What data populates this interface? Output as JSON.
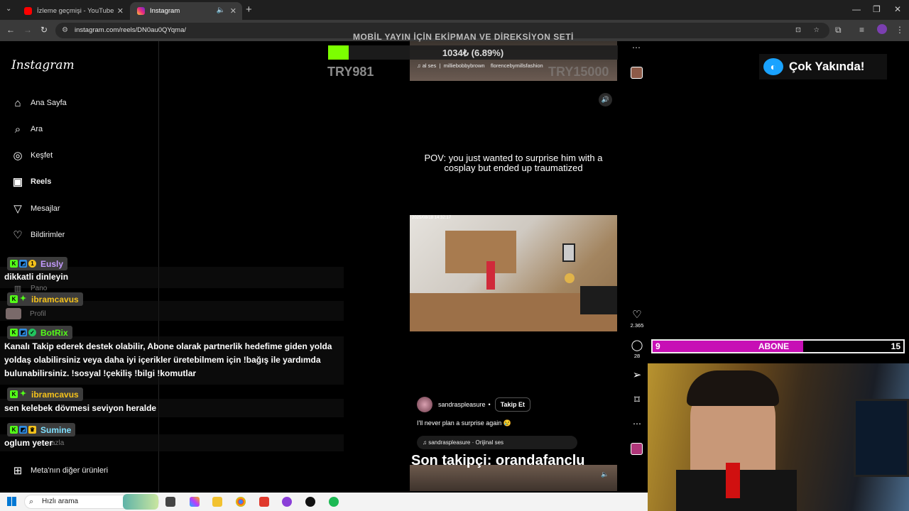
{
  "browser": {
    "tabs": [
      {
        "title": "İzleme geçmişi - YouTube",
        "active": false,
        "favicon_color": "#ff0000"
      },
      {
        "title": "Instagram",
        "active": true,
        "favicon_color": "#e1306c"
      }
    ],
    "url": "instagram.com/reels/DN0au0QYqma/"
  },
  "sidebar": {
    "logo": "Instagram",
    "items": [
      {
        "label": "Ana Sayfa",
        "icon": "home-icon"
      },
      {
        "label": "Ara",
        "icon": "search-icon"
      },
      {
        "label": "Keşfet",
        "icon": "compass-icon"
      },
      {
        "label": "Reels",
        "icon": "reels-icon"
      },
      {
        "label": "Mesajlar",
        "icon": "send-icon"
      },
      {
        "label": "Bildirimler",
        "icon": "heart-icon"
      },
      {
        "label": "Pano",
        "icon": "chart-icon"
      },
      {
        "label": "Profil",
        "icon": "avatar"
      }
    ],
    "more_fragment": "azla",
    "meta_label": "Meta'nın diğer ürünleri"
  },
  "reel": {
    "top_audio": "al ses",
    "top_user": "milliebobbybrown",
    "top_user2": "florencebymillsfashion",
    "caption_overlay": "POV: you just wanted to surprise him with a cosplay but ended up traumatized",
    "cam_timestamp": "2025/08/18 14:32:17",
    "author": "sandraspleasure",
    "follow_label": "Takip Et",
    "caption": "I'll never plan a surprise again 😢",
    "audio": "sandraspleasure · Orijinal ses",
    "likes": "2.365",
    "comments": "28"
  },
  "overlays": {
    "equipment_title": "MOBİL YAYIN İÇİN EKİPMAN VE DİREKSİYON SETİ",
    "goal_text": "1034₺ (6.89%)",
    "goal_progress": 0.0689,
    "goal_fill_color": "#7cff00",
    "price_left": "TRY981",
    "price_right": "TRY15000",
    "coming_soon": "Çok Yakında!",
    "sub_left": "9",
    "sub_label": "ABONE",
    "sub_right": "15",
    "sub_progress": 0.6,
    "sub_color": "#c70fb5",
    "last_follower": "Son takipçi: orandafanclu"
  },
  "chat": [
    {
      "user": "Eusly",
      "color": "#c49bff",
      "message": "dikkatli dinleyin"
    },
    {
      "user": "ibramcavus",
      "color": "#f5c21b",
      "message": ""
    },
    {
      "user": "BotRix",
      "color": "#53fc18",
      "message": "Kanalı Takip ederek destek olabilir, Abone olarak partnerlik hedefime giden yolda yoldaş olabilirsiniz veya daha iyi içerikler üretebilmem için !bağış ile yardımda bulunabilirsiniz. !sosyal !çekiliş !bilgi !komutlar"
    },
    {
      "user": "ibramcavus",
      "color": "#f5c21b",
      "message": "sen kelebek dövmesi seviyon heralde"
    },
    {
      "user": "Sumine",
      "color": "#7fe0ff",
      "message": "oglum yeter"
    }
  ],
  "taskbar": {
    "search_placeholder": "Hızlı arama"
  }
}
